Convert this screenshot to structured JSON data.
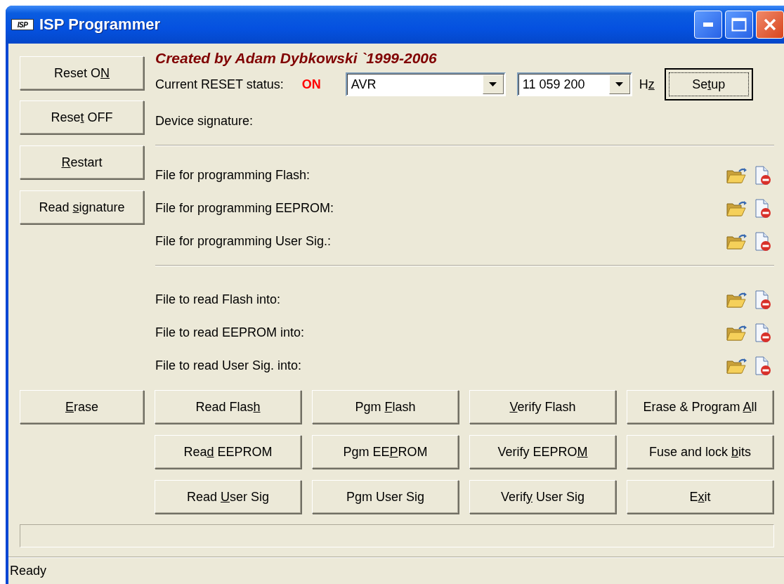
{
  "window": {
    "icon_text": "ISP",
    "title": "ISP Programmer"
  },
  "left_buttons": [
    {
      "label": "Reset O",
      "mnemonic": "N"
    },
    {
      "label": "Rese",
      "mnemonic": "t",
      "label_end": " OFF"
    },
    {
      "mnemonic": "R",
      "label_end": "estart"
    },
    {
      "label": "Read ",
      "mnemonic": "s",
      "label_end": "ignature"
    }
  ],
  "header": {
    "credit": "Created by Adam Dybkowski `1999-2006",
    "status_label": "Current RESET status:",
    "status_value": "ON",
    "device_combo": {
      "value": "AVR"
    },
    "clock_combo": {
      "value": "11 059 200"
    },
    "clock_unit": {
      "label": "H",
      "mnemonic": "z"
    },
    "setup_button": {
      "label": "Se",
      "mnemonic": "t",
      "label_end": "up",
      "default": true
    },
    "signature_label": "Device signature:"
  },
  "file_groups": [
    {
      "rows": [
        {
          "label": "File for programming Flash:"
        },
        {
          "label": "File for programming EEPROM:"
        },
        {
          "label": "File for programming User Sig.:"
        }
      ]
    },
    {
      "rows": [
        {
          "label": "File to read Flash into:"
        },
        {
          "label": "File to read EEPROM into:"
        },
        {
          "label": "File to read User Sig. into:"
        }
      ]
    }
  ],
  "erase_button": {
    "mnemonic": "E",
    "label_end": "rase"
  },
  "action_buttons": [
    [
      {
        "label": "Read Flas",
        "mnemonic": "h"
      },
      {
        "label": "Pgm ",
        "mnemonic": "F",
        "label_end": "lash"
      },
      {
        "mnemonic": "V",
        "label_end": "erify Flash"
      },
      {
        "label": "Erase & Program ",
        "mnemonic": "A",
        "label_end": "ll"
      }
    ],
    [
      {
        "label": "Rea",
        "mnemonic": "d",
        "label_end": " EEPROM"
      },
      {
        "label": "Pgm EE",
        "mnemonic": "P",
        "label_end": "ROM"
      },
      {
        "label": "Verify EEPRO",
        "mnemonic": "M"
      },
      {
        "label": "Fuse and lock ",
        "mnemonic": "b",
        "label_end": "its"
      }
    ],
    [
      {
        "label": "Read ",
        "mnemonic": "U",
        "label_end": "ser Sig"
      },
      {
        "label": "Pgm User Sig"
      },
      {
        "label": "Verif",
        "mnemonic": "y",
        "label_end": " User Sig"
      },
      {
        "label": "E",
        "mnemonic": "x",
        "label_end": "it"
      }
    ]
  ],
  "progress_bar": {
    "level": 0
  },
  "status_bar": {
    "text": "Ready"
  }
}
